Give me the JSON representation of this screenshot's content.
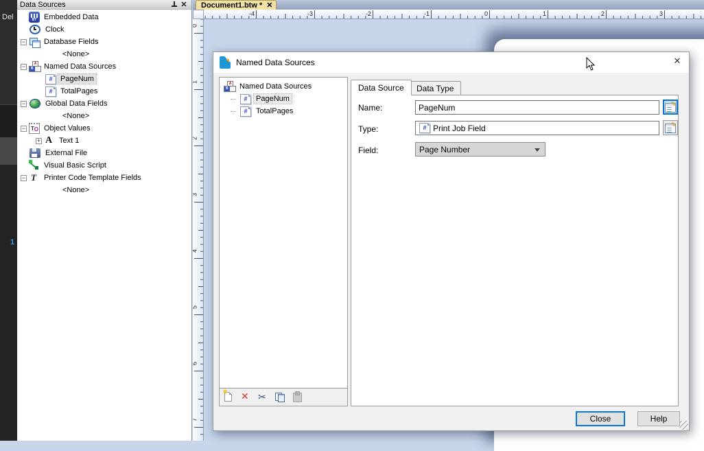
{
  "left_strip": {
    "del_label": "Del",
    "page_number": "1"
  },
  "data_sources_panel": {
    "title": "Data Sources",
    "items": [
      {
        "label": "Embedded Data",
        "icon": "embedded-data",
        "level": 0
      },
      {
        "label": "Clock",
        "icon": "clock",
        "level": 0
      },
      {
        "label": "Database Fields",
        "icon": "database-fields",
        "level": 0,
        "expand": "−"
      },
      {
        "label": "<None>",
        "level": 2
      },
      {
        "label": "Named Data Sources",
        "icon": "abc-blocks",
        "level": 0,
        "expand": "−"
      },
      {
        "label": "PageNum",
        "icon": "page-field",
        "level": 1,
        "selected": true
      },
      {
        "label": "TotalPages",
        "icon": "page-field",
        "level": 1
      },
      {
        "label": "Global Data Fields",
        "icon": "globe",
        "level": 0,
        "expand": "−"
      },
      {
        "label": "<None>",
        "level": 2
      },
      {
        "label": "Object Values",
        "icon": "object-values",
        "level": 0,
        "expand": "−"
      },
      {
        "label": "Text 1",
        "icon": "text",
        "level": 1,
        "expand": "+"
      },
      {
        "label": "External File",
        "icon": "external-file",
        "level": 0
      },
      {
        "label": "Visual Basic Script",
        "icon": "vb-script",
        "level": 0
      },
      {
        "label": "Printer Code Template Fields",
        "icon": "script-t",
        "level": 0,
        "expand": "−"
      },
      {
        "label": "<None>",
        "level": 2
      }
    ]
  },
  "document_tab": {
    "label": "Document1.btw *",
    "close_glyph": "✕"
  },
  "rulers": {
    "horizontal_labels": [
      "-4",
      "-3",
      "-2",
      "-1",
      "0",
      "1",
      "2",
      "3"
    ],
    "vertical_labels": [
      "0",
      "1",
      "2",
      "3",
      "4",
      "5",
      "6",
      "7"
    ]
  },
  "dialog": {
    "title": "Named Data Sources",
    "close_glyph": "✕",
    "tree": {
      "root_label": "Named Data Sources",
      "items": [
        {
          "label": "PageNum",
          "selected": true
        },
        {
          "label": "TotalPages"
        }
      ]
    },
    "toolbar": [
      {
        "name": "new-source",
        "enabled": true
      },
      {
        "name": "delete-source",
        "enabled": true
      },
      {
        "name": "cut",
        "enabled": true
      },
      {
        "name": "copy",
        "enabled": true
      },
      {
        "name": "paste",
        "enabled": false
      }
    ],
    "tabs": [
      {
        "label": "Data Source",
        "active": true
      },
      {
        "label": "Data Type",
        "active": false
      }
    ],
    "form": {
      "name_label": "Name:",
      "name_value": "PageNum",
      "type_label": "Type:",
      "type_value": "Print Job Field",
      "field_label": "Field:",
      "field_value": "Page Number"
    },
    "buttons": {
      "close": "Close",
      "help": "Help"
    }
  }
}
